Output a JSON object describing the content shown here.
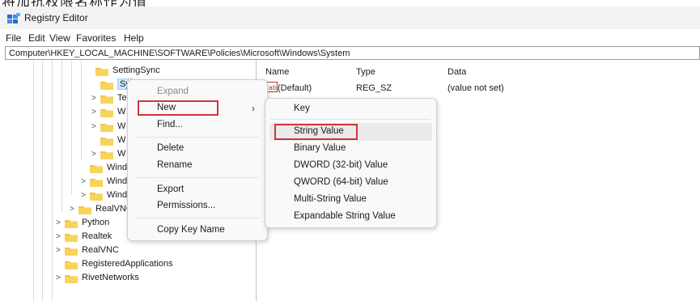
{
  "top_cropped_text": "将加抗权限名称作为值",
  "window": {
    "title": "Registry Editor"
  },
  "menubar": {
    "items": [
      "File",
      "Edit",
      "View",
      "Favorites",
      "Help"
    ]
  },
  "address": {
    "path": "Computer\\HKEY_LOCAL_MACHINE\\SOFTWARE\\Policies\\Microsoft\\Windows\\System"
  },
  "tree": {
    "nodes": [
      {
        "label": "SettingSync",
        "expandable": false,
        "selected": false
      },
      {
        "label": "Sy",
        "expandable": false,
        "selected": true
      },
      {
        "label": "Te",
        "expandable": true,
        "selected": false
      },
      {
        "label": "W",
        "expandable": true,
        "selected": false
      },
      {
        "label": "W",
        "expandable": true,
        "selected": false
      },
      {
        "label": "W",
        "expandable": false,
        "selected": false
      },
      {
        "label": "W",
        "expandable": true,
        "selected": false
      },
      {
        "label": "Wind",
        "expandable": false,
        "selected": false
      },
      {
        "label": "Wind",
        "expandable": true,
        "selected": false
      },
      {
        "label": "Wind",
        "expandable": true,
        "selected": false
      },
      {
        "label": "RealVNC",
        "expandable": true,
        "selected": false
      },
      {
        "label": "Python",
        "expandable": true,
        "selected": false
      },
      {
        "label": "Realtek",
        "expandable": true,
        "selected": false
      },
      {
        "label": "RealVNC",
        "expandable": true,
        "selected": false
      },
      {
        "label": "RegisteredApplications",
        "expandable": false,
        "selected": false
      },
      {
        "label": "RivetNetworks",
        "expandable": true,
        "selected": false
      }
    ]
  },
  "values_pane": {
    "headers": {
      "name": "Name",
      "type": "Type",
      "data": "Data"
    },
    "rows": [
      {
        "name": "(Default)",
        "type": "REG_SZ",
        "data": "(value not set)"
      }
    ]
  },
  "context_menu": {
    "expand": "Expand",
    "new": "New",
    "find": "Find...",
    "delete": "Delete",
    "rename": "Rename",
    "export": "Export",
    "permissions": "Permissions...",
    "copy_key_name": "Copy Key Name",
    "submenu_arrow": "›"
  },
  "submenu": {
    "key": "Key",
    "string_value": "String Value",
    "binary_value": "Binary Value",
    "dword": "DWORD (32-bit) Value",
    "qword": "QWORD (64-bit) Value",
    "multi_string": "Multi-String Value",
    "expandable_string": "Expandable String Value"
  },
  "colors": {
    "highlight_box": "#d13438",
    "folder": "#f4c542",
    "selection": "#cce8ff"
  }
}
